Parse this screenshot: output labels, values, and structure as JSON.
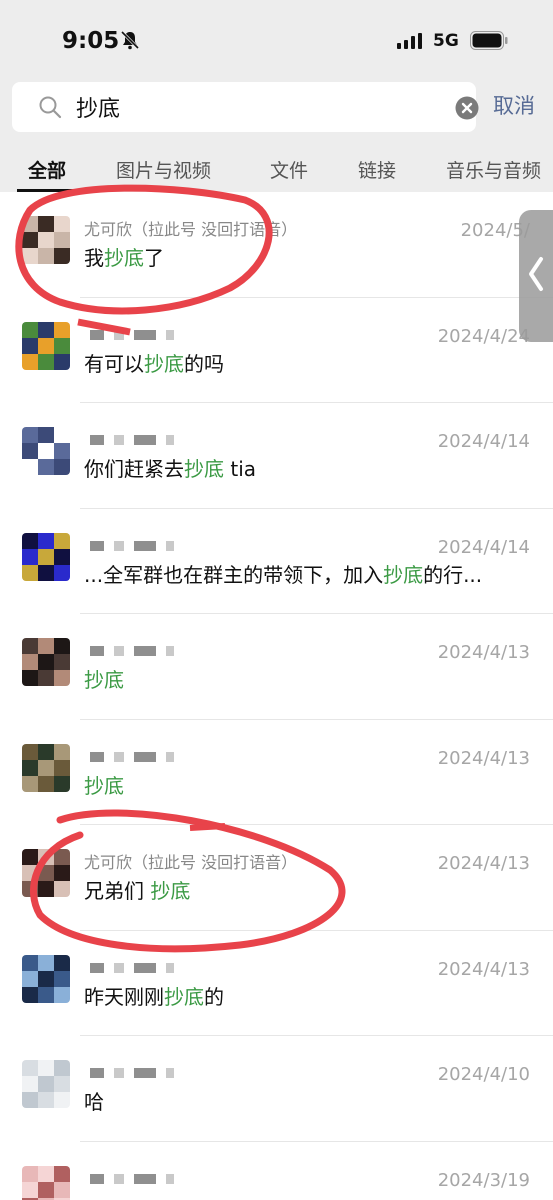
{
  "status_bar": {
    "time": "9:05",
    "network": "5G",
    "icons": [
      "bell-muted-icon",
      "signal-icon",
      "battery-icon"
    ]
  },
  "search": {
    "query": "抄底",
    "cancel_label": "取消",
    "icons": [
      "search-icon",
      "clear-icon"
    ]
  },
  "tabs": [
    {
      "label": "全部",
      "active": true
    },
    {
      "label": "图片与视频",
      "active": false
    },
    {
      "label": "文件",
      "active": false
    },
    {
      "label": "链接",
      "active": false
    },
    {
      "label": "音乐与音频",
      "active": false
    }
  ],
  "results": [
    {
      "sender": "尤可欣（拉此号 没回打语音）",
      "pre": "我",
      "hl": "抄底",
      "post": "了",
      "date": "2024/5/",
      "avatar": [
        "#c9b5a8",
        "#3a2b24",
        "#e8d6cc"
      ]
    },
    {
      "sender": "",
      "pre": "有可以",
      "hl": "抄底",
      "post": "的吗",
      "date": "2024/4/24",
      "avatar": [
        "#4a8b3c",
        "#2a3b6a",
        "#e8a02a"
      ]
    },
    {
      "sender": "",
      "pre": "你们赶紧去",
      "hl": "抄底",
      "post": " tia",
      "date": "2024/4/14",
      "avatar": [
        "#5a6a9a",
        "#3c4a78",
        "#ffffff"
      ]
    },
    {
      "sender": "",
      "pre": "...全军群也在群主的带领下，加入",
      "hl": "抄底",
      "post": "的行...",
      "date": "2024/4/14",
      "avatar": [
        "#101040",
        "#2a2acc",
        "#c8a83a"
      ]
    },
    {
      "sender": "",
      "pre": "",
      "hl": "抄底",
      "post": "",
      "date": "2024/4/13",
      "avatar": [
        "#4a3a35",
        "#b28a78",
        "#1d1716"
      ]
    },
    {
      "sender": "",
      "pre": "",
      "hl": "抄底",
      "post": "",
      "date": "2024/4/13",
      "avatar": [
        "#6a5a3a",
        "#2a3a2a",
        "#a89878"
      ]
    },
    {
      "sender": "尤可欣（拉此号 没回打语音）",
      "pre": "兄弟们 ",
      "hl": "抄底",
      "post": "",
      "date": "2024/4/13",
      "avatar": [
        "#2a1a18",
        "#d8c0b6",
        "#7a5a50"
      ]
    },
    {
      "sender": "",
      "pre": "昨天刚刚",
      "hl": "抄底",
      "post": "的",
      "date": "2024/4/13",
      "avatar": [
        "#3a5a8a",
        "#8ab0d8",
        "#1a2a48"
      ]
    },
    {
      "sender": "",
      "pre": "哈",
      "hl": "",
      "post": "",
      "date": "2024/4/10",
      "avatar": [
        "#d8dde2",
        "#f0f2f4",
        "#c0c8d0"
      ]
    },
    {
      "sender": "",
      "pre": "",
      "hl": "",
      "post": "",
      "date": "2024/3/19",
      "avatar": [
        "#e8b8b8",
        "#f5d5d5",
        "#b06060"
      ]
    }
  ],
  "colors": {
    "highlight": "#3b9a44",
    "cancel": "#576b95",
    "annotation": "#e8434a"
  }
}
